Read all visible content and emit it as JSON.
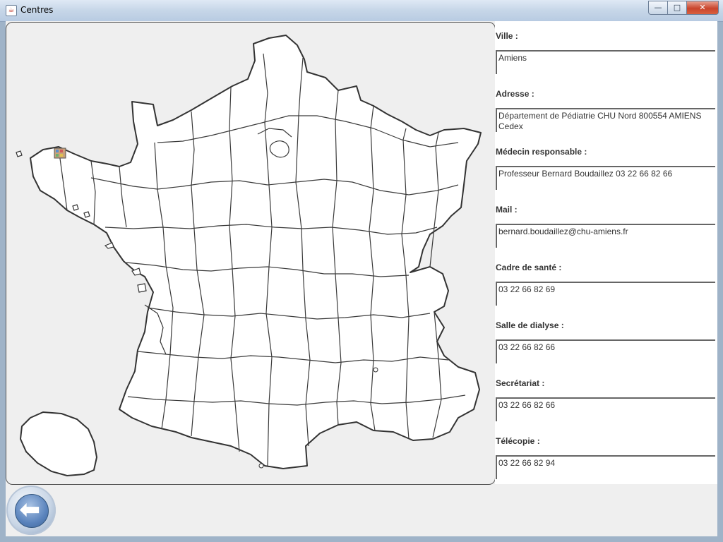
{
  "window": {
    "title": "Centres",
    "buttons": {
      "minimize": "—",
      "maximize": "□",
      "close": "✕"
    }
  },
  "form": {
    "fields": [
      {
        "label": "Ville :",
        "value": "Amiens"
      },
      {
        "label": "Adresse :",
        "value": "Département de Pédiatrie CHU Nord 800554 AMIENS Cedex"
      },
      {
        "label": "Médecin responsable :",
        "value": "Professeur Bernard Boudaillez 03 22 66 82 66"
      },
      {
        "label": "Mail :",
        "value": "bernard.boudaillez@chu-amiens.fr"
      },
      {
        "label": "Cadre de santé :",
        "value": "03 22 66 82 69"
      },
      {
        "label": "Salle de dialyse :",
        "value": "03 22 66 82 66"
      },
      {
        "label": "Secrétariat :",
        "value": "03 22 66 82 66"
      },
      {
        "label": "Télécopie :",
        "value": "03 22 66 82 94"
      }
    ]
  },
  "map": {
    "icon": "map-marker-icon",
    "colors": {
      "land": "#ffffff",
      "border": "#333333",
      "background": "#efefef"
    }
  },
  "back": {
    "icon": "arrow-left-icon",
    "glyph": "⬅"
  }
}
